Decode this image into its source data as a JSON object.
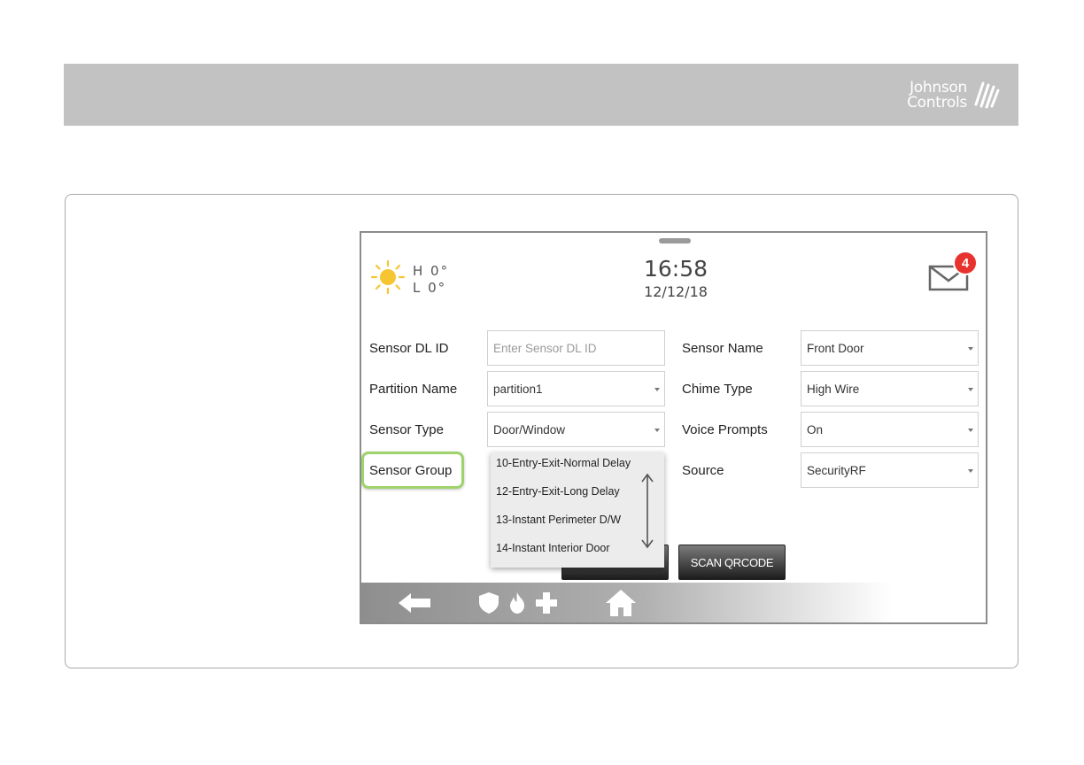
{
  "brand": {
    "line1": "Johnson",
    "line2": "Controls"
  },
  "weather": {
    "icon": "sun-icon",
    "high": "H 0°",
    "low": "L 0°"
  },
  "clock": {
    "time": "16:58",
    "date": "12/12/18"
  },
  "messages": {
    "icon": "mail-icon",
    "count": "4"
  },
  "form": {
    "sensor_dl_id": {
      "label": "Sensor DL ID",
      "placeholder": "Enter Sensor DL ID"
    },
    "sensor_name": {
      "label": "Sensor Name",
      "value": "Front Door"
    },
    "partition_name": {
      "label": "Partition Name",
      "value": "partition1"
    },
    "chime_type": {
      "label": "Chime Type",
      "value": "High Wire"
    },
    "sensor_type": {
      "label": "Sensor Type",
      "value": "Door/Window"
    },
    "voice_prompts": {
      "label": "Voice Prompts",
      "value": "On"
    },
    "sensor_group": {
      "label": "Sensor Group"
    },
    "source": {
      "label": "Source",
      "value": "SecurityRF"
    }
  },
  "sensor_group_options": [
    "10-Entry-Exit-Normal Delay",
    "12-Entry-Exit-Long Delay",
    "13-Instant Perimeter D/W",
    "14-Instant Interior Door"
  ],
  "buttons": {
    "scan_qrcode": "SCAN QRCODE"
  },
  "nav": [
    "back-arrow-icon",
    "shield-icon",
    "fire-icon",
    "plus-icon",
    "home-icon"
  ],
  "colors": {
    "highlight": "#9ed36c",
    "badge": "#e8322d",
    "header": "#c2c2c2"
  }
}
